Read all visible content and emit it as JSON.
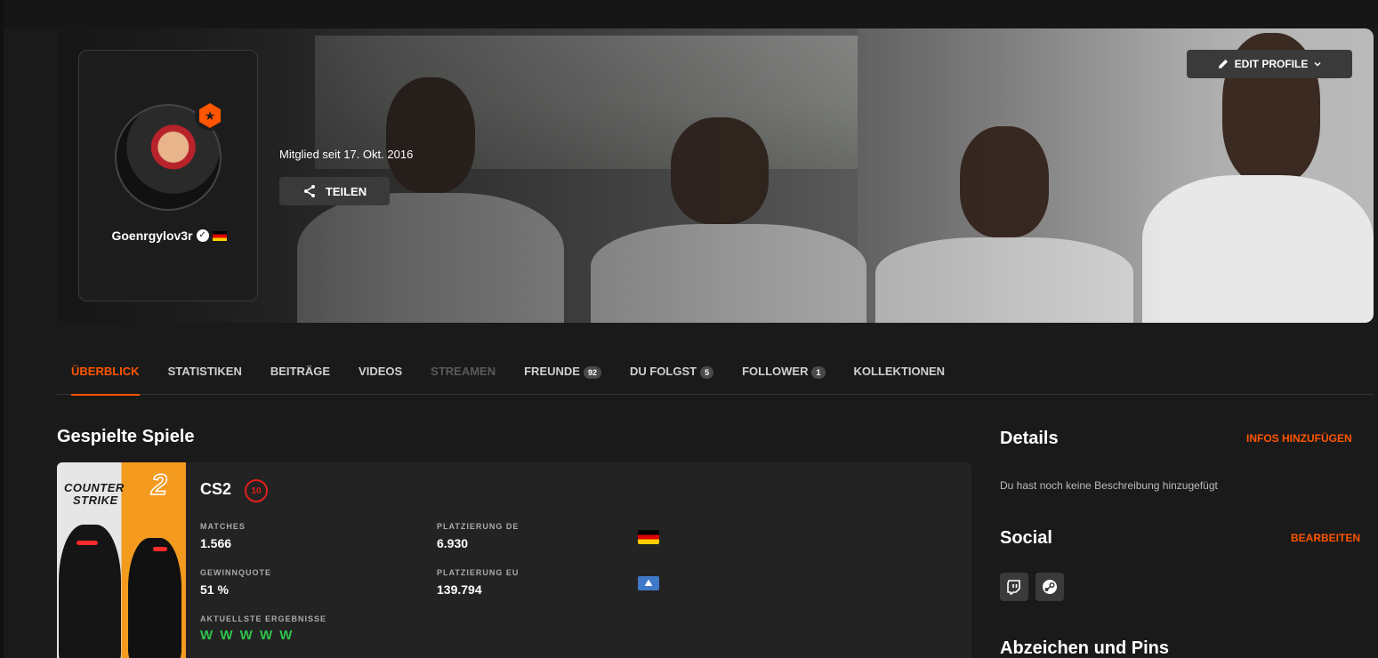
{
  "profile": {
    "nickname": "Goenrgylov3r",
    "member_since": "Mitglied seit 17. Okt. 2016",
    "share_label": "TEILEN",
    "edit_label": "EDIT PROFILE",
    "verified_icon": "verified-check-icon",
    "country_flag": "germany-flag-icon"
  },
  "tabs": [
    {
      "label": "ÜBERBLICK",
      "active": true
    },
    {
      "label": "STATISTIKEN"
    },
    {
      "label": "BEITRÄGE"
    },
    {
      "label": "VIDEOS"
    },
    {
      "label": "STREAMEN",
      "disabled": true
    },
    {
      "label": "FREUNDE",
      "count": "92"
    },
    {
      "label": "DU FOLGST",
      "count": "5"
    },
    {
      "label": "FOLLOWER",
      "count": "1"
    },
    {
      "label": "KOLLEKTIONEN"
    }
  ],
  "games": {
    "title": "Gespielte Spiele",
    "cover_line1": "COUNTER",
    "cover_line2": "STRIKE",
    "cover_num": "2",
    "game_name": "CS2",
    "level": "10",
    "matches_label": "MATCHES",
    "matches_value": "1.566",
    "winrate_label": "GEWINNQUOTE",
    "winrate_value": "51 %",
    "rank_de_label": "PLATZIERUNG DE",
    "rank_de_value": "6.930",
    "rank_eu_label": "PLATZIERUNG EU",
    "rank_eu_value": "139.794",
    "recent_label": "AKTUELLSTE ERGEBNISSE",
    "recent_results": "W W W W W"
  },
  "sidebar": {
    "details_title": "Details",
    "details_link": "INFOS HINZUFÜGEN",
    "details_desc": "Du hast noch keine Beschreibung hinzugefügt",
    "social_title": "Social",
    "social_link": "BEARBEITEN",
    "social_icons": [
      "twitch-icon",
      "steam-icon"
    ],
    "badges_title": "Abzeichen und Pins"
  },
  "colors": {
    "accent": "#ff5500",
    "win": "#2ec44b",
    "level_red": "#e0201c"
  }
}
